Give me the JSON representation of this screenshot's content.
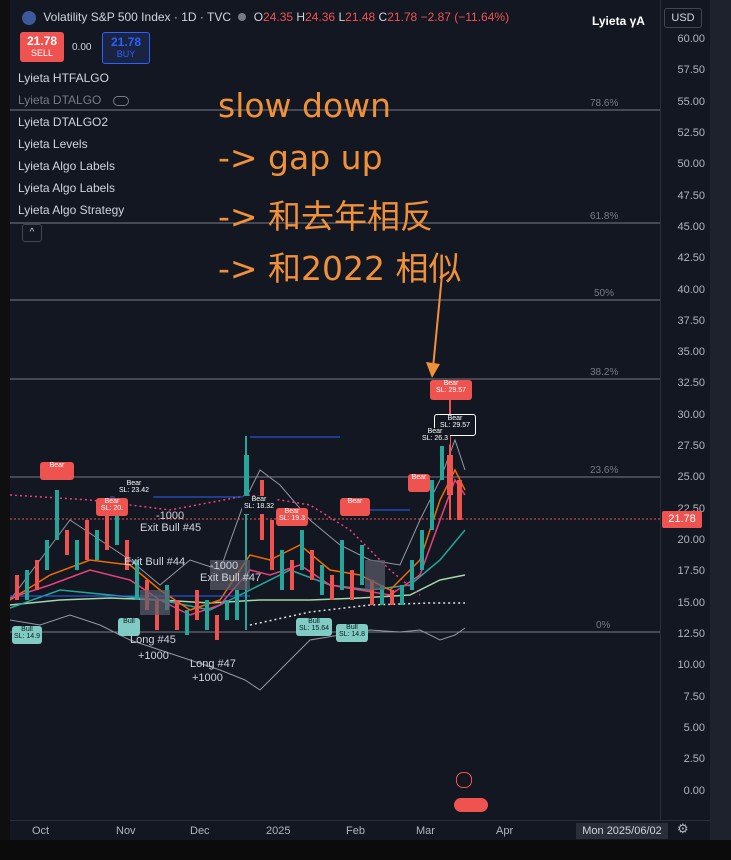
{
  "header": {
    "symbol_title": "Volatility S&P 500 Index · 1D · TVC",
    "ohlc": {
      "o_label": "O",
      "o": "24.35",
      "h_label": "H",
      "h": "24.36",
      "l_label": "L",
      "l": "21.48",
      "c_label": "C",
      "c": "21.78",
      "change": "−2.87 (−11.64%)"
    },
    "brand": "Lyieta γA",
    "currency": "USD"
  },
  "trade": {
    "sell_price": "21.78",
    "sell_label": "SELL",
    "spread": "0.00",
    "buy_price": "21.78",
    "buy_label": "BUY"
  },
  "indicators": [
    "Lyieta HTFALGO",
    "Lyieta DTALGO",
    "Lyieta DTALGO2",
    "Lyieta Levels",
    "Lyieta Algo Labels",
    "Lyieta Algo Labels",
    "Lyieta Algo Strategy"
  ],
  "annotation": {
    "line1": "slow down",
    "line2": "-> gap up",
    "line3": "-> 和去年相反",
    "line4": "-> 和2022 相似"
  },
  "price_axis": {
    "ticks": [
      "60.00",
      "57.50",
      "55.00",
      "52.50",
      "50.00",
      "47.50",
      "45.00",
      "42.50",
      "40.00",
      "37.50",
      "35.00",
      "32.50",
      "30.00",
      "27.50",
      "25.00",
      "22.50",
      "20.00",
      "17.50",
      "15.00",
      "12.50",
      "10.00",
      "7.50",
      "5.00",
      "2.50",
      "0.00"
    ],
    "current_price": "21.78"
  },
  "fib_levels": [
    "78.6%",
    "61.8%",
    "50%",
    "38.2%",
    "23.6%",
    "0%"
  ],
  "time_axis": {
    "months": [
      "Oct",
      "Nov",
      "Dec",
      "2025",
      "Feb",
      "Mar",
      "Apr"
    ],
    "crosshair_date": "Mon 2025/06/02"
  },
  "chart_labels": {
    "bear": "Bear",
    "bull": "Bull",
    "sl_values": [
      "SL: 29.57",
      "SL: 29.57",
      "SL: 26.3",
      "SL: 23.42",
      "SL: 20.",
      "SL: 18.32",
      "SL: 19.3",
      "SL: 14.9",
      "SL: 15.64",
      "SL: 14.8"
    ],
    "exit1": "Exit Bull #45",
    "exit2": "Exit Bull #44",
    "exit3": "Exit Bull #47",
    "long1": "Long #45",
    "long2": "Long #47",
    "neg1000": "-1000",
    "pos1000": "+1000"
  },
  "colors": {
    "bear": "#ef5350",
    "bull": "#26a69a",
    "annotation": "#f0913a",
    "accent": "#2962ff"
  }
}
